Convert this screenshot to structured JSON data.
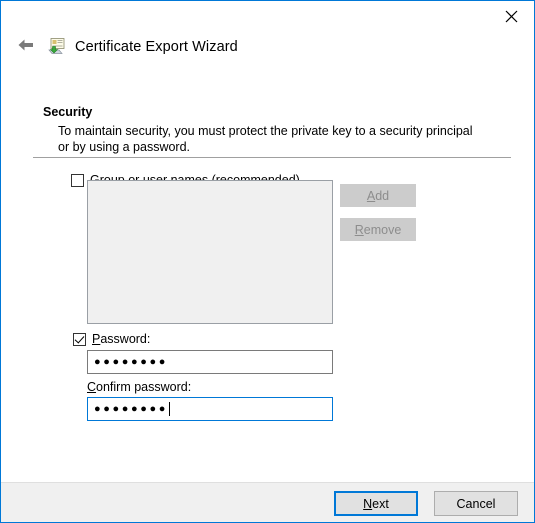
{
  "window": {
    "title": "Certificate Export Wizard",
    "accent_color": "#0078d7",
    "close_icon": "close-icon",
    "back_icon": "back-arrow-icon",
    "wizard_icon": "certificate-export-icon"
  },
  "section": {
    "heading": "Security",
    "description": "To maintain security, you must protect the private key to a security principal or by using a password."
  },
  "group_names": {
    "checkbox_label_pre": "G",
    "checkbox_label_post": "roup or user names (recommended)",
    "checked": false,
    "list_items": []
  },
  "side_buttons": {
    "add": {
      "pre": "A",
      "post": "dd",
      "enabled": false
    },
    "remove": {
      "pre": "R",
      "post": "emove",
      "enabled": false
    }
  },
  "password": {
    "checkbox_pre": "P",
    "checkbox_post": "assword:",
    "checked": true,
    "value_dots": "●●●●●●●●",
    "focused": false
  },
  "confirm_password": {
    "label_pre": "C",
    "label_post": "onfirm password:",
    "value_dots": "●●●●●●●●",
    "focused": true
  },
  "footer": {
    "next": {
      "pre": "N",
      "post": "ext",
      "is_default": true
    },
    "cancel": {
      "pre": "",
      "post": "Cancel",
      "is_default": false
    }
  }
}
